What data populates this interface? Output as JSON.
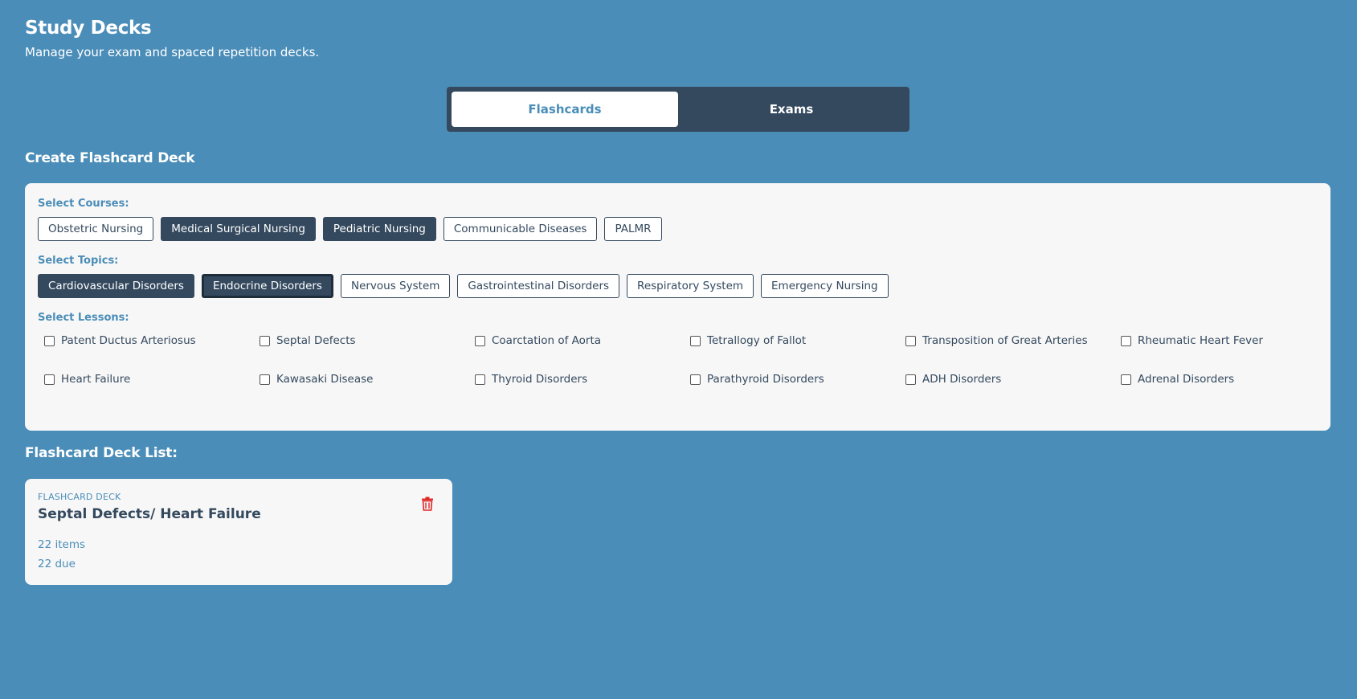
{
  "header": {
    "title": "Study Decks",
    "subtitle": "Manage your exam and spaced repetition decks."
  },
  "tabs": [
    {
      "label": "Flashcards",
      "active": true
    },
    {
      "label": "Exams",
      "active": false
    }
  ],
  "create": {
    "title": "Create Flashcard Deck",
    "courses_label": "Select Courses:",
    "courses": [
      {
        "label": "Obstetric Nursing",
        "selected": false
      },
      {
        "label": "Medical Surgical Nursing",
        "selected": true
      },
      {
        "label": "Pediatric Nursing",
        "selected": true
      },
      {
        "label": "Communicable Diseases",
        "selected": false
      },
      {
        "label": "PALMR",
        "selected": false
      }
    ],
    "topics_label": "Select Topics:",
    "topics": [
      {
        "label": "Cardiovascular Disorders",
        "selected": true
      },
      {
        "label": "Endocrine Disorders",
        "selected": true
      },
      {
        "label": "Nervous System",
        "selected": false
      },
      {
        "label": "Gastrointestinal Disorders",
        "selected": false
      },
      {
        "label": "Respiratory System",
        "selected": false
      },
      {
        "label": "Emergency Nursing",
        "selected": false
      }
    ],
    "lessons_label": "Select Lessons:",
    "lessons": [
      "Patent Ductus Arteriosus",
      "Septal Defects",
      "Coarctation of Aorta",
      "Tetrallogy of Fallot",
      "Transposition of Great Arteries",
      "Rheumatic Heart Fever",
      "Heart Failure",
      "Kawasaki Disease",
      "Thyroid Disorders",
      "Parathyroid Disorders",
      "ADH Disorders",
      "Adrenal Disorders"
    ]
  },
  "deck_list": {
    "title": "Flashcard Deck List:",
    "decks": [
      {
        "kicker": "FLASHCARD DECK",
        "name": "Septal Defects/ Heart Failure",
        "items": "22 items",
        "due": "22 due",
        "icon": "trash-icon"
      }
    ]
  },
  "colors": {
    "background": "#4a8db8",
    "dark": "#34495e",
    "card": "#f7f7f7",
    "danger": "#e02424"
  }
}
